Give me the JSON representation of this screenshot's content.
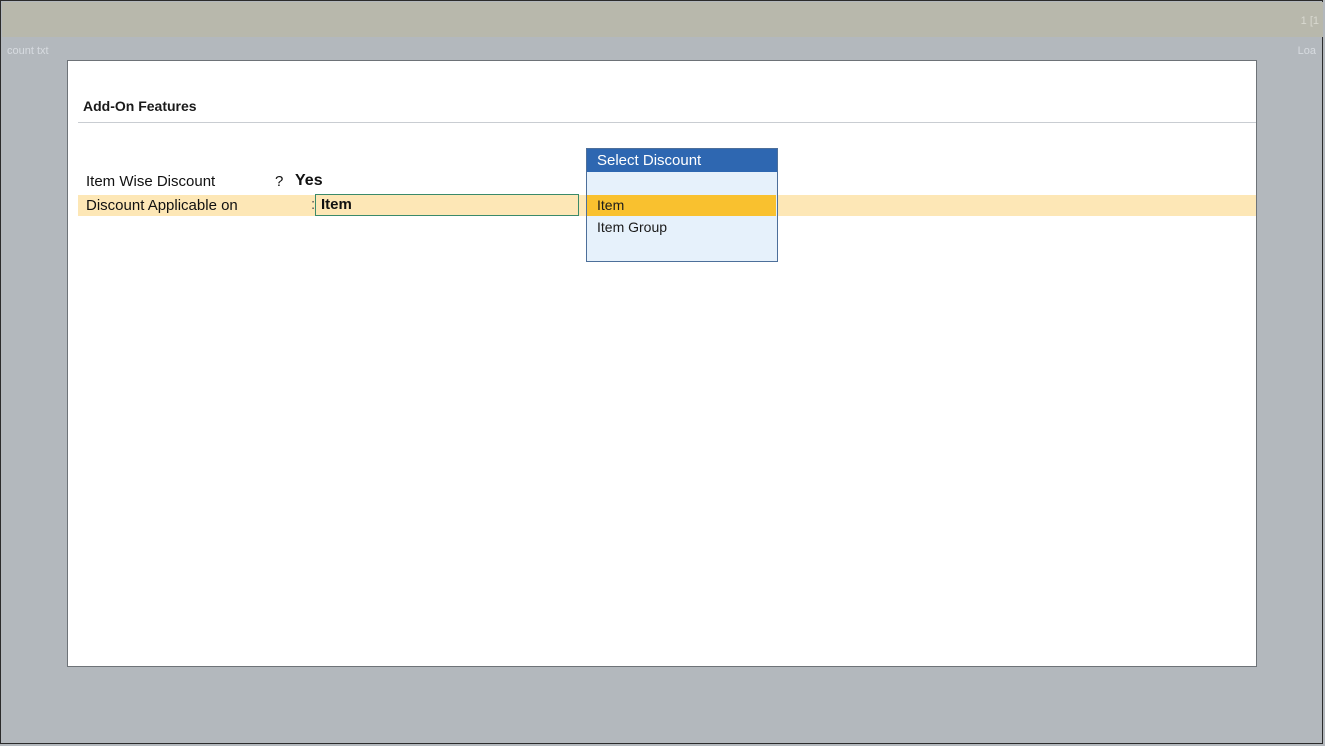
{
  "topbar": {
    "counter": "1 [1"
  },
  "background": {
    "left_label": "count txt",
    "right_label": "Loa"
  },
  "panel": {
    "title": "Add-On Features",
    "fields": {
      "item_wise_discount": {
        "label": "Item Wise Discount",
        "separator": "?",
        "value": "Yes"
      },
      "discount_applicable_on": {
        "label": "Discount Applicable on",
        "separator": ":",
        "value": "Item"
      }
    }
  },
  "popup": {
    "title": "Select Discount",
    "options": [
      "Item",
      "Item Group"
    ],
    "selected": "Item"
  },
  "colors": {
    "background": "#b3b8bd",
    "highlight_row": "#fde7b6",
    "popup_header": "#2e67b1",
    "popup_selected": "#f9c12f",
    "popup_body": "#e6f1fb"
  }
}
